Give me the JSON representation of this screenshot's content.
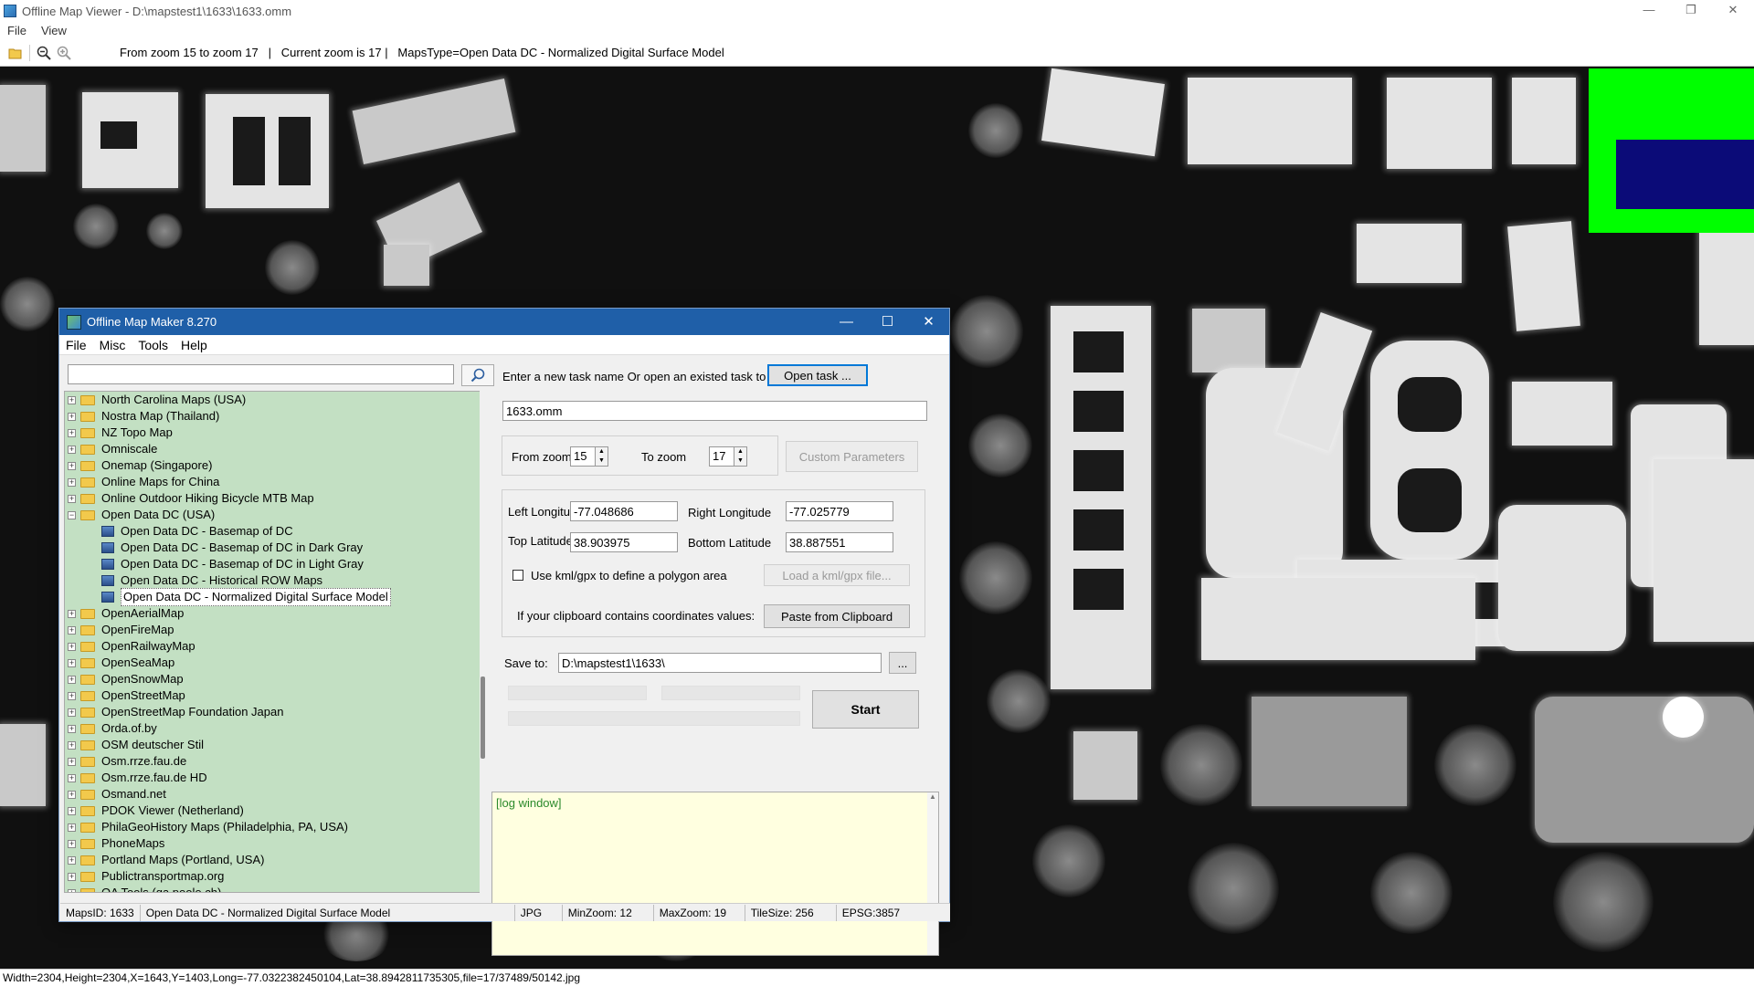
{
  "window": {
    "title": "Offline Map Viewer - D:\\mapstest1\\1633\\1633.omm",
    "minimize": "—",
    "maximize": "❐",
    "close": "✕"
  },
  "menubar": {
    "file": "File",
    "view": "View"
  },
  "toolbar": {
    "info": "From zoom 15 to zoom 17   |   Current zoom is 17 |   MapsType=Open Data DC - Normalized Digital Surface Model"
  },
  "status_bar": {
    "text": "Width=2304,Height=2304,X=1643,Y=1403,Long=-77.0322382450104,Lat=38.8942811735305,file=17/37489/50142.jpg"
  },
  "dialog": {
    "title": "Offline Map Maker 8.270",
    "minimize": "—",
    "maximize": "☐",
    "close": "✕",
    "menu": {
      "file": "File",
      "misc": "Misc",
      "tools": "Tools",
      "help": "Help"
    },
    "search": {
      "value": "",
      "placeholder": ""
    },
    "tree": {
      "items": [
        {
          "label": "North Carolina Maps (USA)",
          "expand": "+"
        },
        {
          "label": "Nostra Map (Thailand)",
          "expand": "+"
        },
        {
          "label": "NZ Topo Map",
          "expand": "+"
        },
        {
          "label": "Omniscale",
          "expand": "+"
        },
        {
          "label": "Onemap (Singapore)",
          "expand": "+"
        },
        {
          "label": "Online Maps for China",
          "expand": "+"
        },
        {
          "label": "Online Outdoor Hiking Bicycle MTB Map",
          "expand": "+"
        },
        {
          "label": "Open Data DC (USA)",
          "expand": "−"
        },
        {
          "label": "Open Data DC - Basemap of DC"
        },
        {
          "label": "Open Data DC - Basemap of DC in Dark Gray"
        },
        {
          "label": "Open Data DC - Basemap of DC in Light Gray"
        },
        {
          "label": "Open Data DC - Historical ROW Maps"
        },
        {
          "label": "Open Data DC - Normalized Digital Surface Model"
        },
        {
          "label": "OpenAerialMap",
          "expand": "+"
        },
        {
          "label": "OpenFireMap",
          "expand": "+"
        },
        {
          "label": "OpenRailwayMap",
          "expand": "+"
        },
        {
          "label": "OpenSeaMap",
          "expand": "+"
        },
        {
          "label": "OpenSnowMap",
          "expand": "+"
        },
        {
          "label": "OpenStreetMap",
          "expand": "+"
        },
        {
          "label": "OpenStreetMap Foundation Japan",
          "expand": "+"
        },
        {
          "label": "Orda.of.by",
          "expand": "+"
        },
        {
          "label": "OSM deutscher Stil",
          "expand": "+"
        },
        {
          "label": "Osm.rrze.fau.de",
          "expand": "+"
        },
        {
          "label": "Osm.rrze.fau.de HD",
          "expand": "+"
        },
        {
          "label": "Osmand.net",
          "expand": "+"
        },
        {
          "label": "PDOK Viewer (Netherland)",
          "expand": "+"
        },
        {
          "label": "PhilaGeoHistory Maps (Philadelphia, PA, USA)",
          "expand": "+"
        },
        {
          "label": "PhoneMaps",
          "expand": "+"
        },
        {
          "label": "Portland Maps (Portland, USA)",
          "expand": "+"
        },
        {
          "label": "Publictransportmap.org",
          "expand": "+"
        },
        {
          "label": "QA Tools (qa.poole.ch)",
          "expand": "+"
        }
      ]
    },
    "task": {
      "prompt": "Enter a new task name Or open an existed task to continue:",
      "open_button": "Open task ...",
      "name_value": "1633.omm"
    },
    "zoom": {
      "from_label": "From zoom",
      "from_value": "15",
      "to_label": "To zoom",
      "to_value": "17",
      "custom_button": "Custom Parameters"
    },
    "coords": {
      "left_lon_label": "Left Longitude",
      "left_lon": "-77.048686",
      "right_lon_label": "Right Longitude",
      "right_lon": "-77.025779",
      "top_lat_label": "Top Latitude",
      "top_lat": "38.903975",
      "bottom_lat_label": "Bottom Latitude",
      "bottom_lat": "38.887551",
      "kml_label": "Use kml/gpx to define a polygon area",
      "kml_button": "Load a kml/gpx file...",
      "clipboard_label": "If your clipboard contains coordinates values:",
      "clipboard_button": "Paste from Clipboard"
    },
    "save": {
      "label": "Save to:",
      "path": "D:\\mapstest1\\1633\\",
      "browse": "...",
      "start": "Start"
    },
    "log": {
      "text": "[log window]"
    },
    "status": {
      "maps_id": "MapsID: 1633",
      "maps_name": "Open Data DC - Normalized Digital Surface Model",
      "format": "JPG",
      "min_zoom": "MinZoom: 12",
      "max_zoom": "MaxZoom: 19",
      "tile_size": "TileSize: 256",
      "epsg": "EPSG:3857"
    }
  },
  "colors": {
    "map_background": "#101010",
    "tree_background": "#c3e0c3",
    "overlay_green": "#00ff00",
    "overlay_blue": "#0b0b78",
    "log_background": "#ffffe0",
    "dialog_title": "#1f5fa8"
  }
}
